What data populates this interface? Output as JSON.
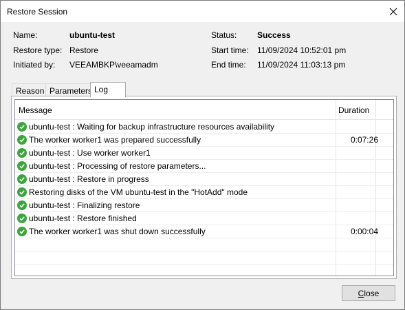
{
  "window": {
    "title": "Restore Session"
  },
  "summary": {
    "name_label": "Name:",
    "name_value": "ubuntu-test",
    "type_label": "Restore type:",
    "type_value": "Restore",
    "init_label": "Initiated by:",
    "init_value": "VEEAMBKP\\veeamadm",
    "status_label": "Status:",
    "status_value": "Success",
    "start_label": "Start time:",
    "start_value": "11/09/2024 10:52:01 pm",
    "end_label": "End time:",
    "end_value": "11/09/2024 11:03:13 pm"
  },
  "tabs": [
    {
      "label": "Reason"
    },
    {
      "label": "Parameters"
    },
    {
      "label": "Log",
      "active": true
    }
  ],
  "log": {
    "columns": {
      "message": "Message",
      "duration": "Duration"
    },
    "rows": [
      {
        "message": "ubuntu-test : Waiting for backup infrastructure resources availability",
        "duration": ""
      },
      {
        "message": "The worker worker1 was prepared successfully",
        "duration": "0:07:26"
      },
      {
        "message": "ubuntu-test : Use worker worker1",
        "duration": ""
      },
      {
        "message": "ubuntu-test : Processing of restore parameters...",
        "duration": ""
      },
      {
        "message": "ubuntu-test : Restore in progress",
        "duration": ""
      },
      {
        "message": "Restoring disks of the VM ubuntu-test in the \"HotAdd\" mode",
        "duration": ""
      },
      {
        "message": "ubuntu-test : Finalizing restore",
        "duration": ""
      },
      {
        "message": "ubuntu-test : Restore finished",
        "duration": ""
      },
      {
        "message": "The worker worker1 was shut down successfully",
        "duration": "0:00:04"
      }
    ],
    "status_icon": "success-check-icon",
    "status_color": "#3ca63c"
  },
  "buttons": {
    "close_accel": "C",
    "close_rest": "lose"
  }
}
